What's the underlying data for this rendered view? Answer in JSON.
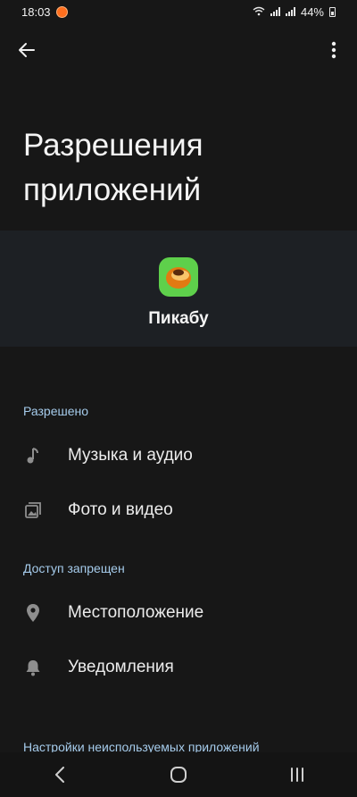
{
  "status_bar": {
    "time": "18:03",
    "battery": "44%",
    "notification_icon": "app-notification-icon"
  },
  "topbar": {
    "back_icon": "arrow-left-icon",
    "more_icon": "more-vertical-icon"
  },
  "page": {
    "title_line1": "Разрешения",
    "title_line2": "приложений"
  },
  "app": {
    "name": "Пикабу",
    "icon": "pikabu-app-icon"
  },
  "sections": {
    "allowed": {
      "label": "Разрешено",
      "items": [
        {
          "label": "Музыка и аудио",
          "icon": "music-note-icon"
        },
        {
          "label": "Фото и видео",
          "icon": "photo-video-icon"
        }
      ]
    },
    "denied": {
      "label": "Доступ запрещен",
      "items": [
        {
          "label": "Местоположение",
          "icon": "location-pin-icon"
        },
        {
          "label": "Уведомления",
          "icon": "bell-icon"
        }
      ]
    },
    "unused_settings_label": "Настройки неиспользуемых приложений"
  },
  "navbar": {
    "back": "nav-back-icon",
    "home": "nav-home-icon",
    "recents": "nav-recents-icon"
  },
  "colors": {
    "background": "#171717",
    "card": "#1d2024",
    "section_label": "#a6ccec",
    "app_icon_green": "#5ed04b"
  }
}
